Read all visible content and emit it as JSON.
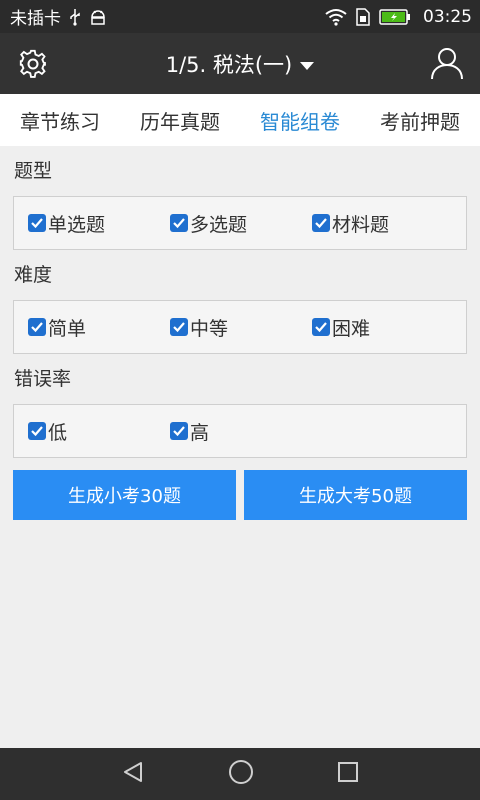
{
  "status_bar": {
    "carrier": "未插卡",
    "time": "03:25",
    "icons": [
      "usb-icon",
      "android-icon",
      "wifi-icon",
      "sim-icon",
      "battery-icon"
    ]
  },
  "header": {
    "title": "1/5. 税法(一)",
    "icons": [
      "gear-icon",
      "chevron-down-icon",
      "user-icon"
    ]
  },
  "tabs": [
    {
      "label": "章节练习",
      "active": false
    },
    {
      "label": "历年真题",
      "active": false
    },
    {
      "label": "智能组卷",
      "active": true
    },
    {
      "label": "考前押题",
      "active": false
    }
  ],
  "sections": {
    "type": {
      "label": "题型",
      "options": [
        {
          "label": "单选题",
          "checked": true
        },
        {
          "label": "多选题",
          "checked": true
        },
        {
          "label": "材料题",
          "checked": true
        }
      ]
    },
    "difficulty": {
      "label": "难度",
      "options": [
        {
          "label": "简单",
          "checked": true
        },
        {
          "label": "中等",
          "checked": true
        },
        {
          "label": "困难",
          "checked": true
        }
      ]
    },
    "error_rate": {
      "label": "错误率",
      "options": [
        {
          "label": "低",
          "checked": true
        },
        {
          "label": "高",
          "checked": true
        }
      ]
    }
  },
  "buttons": {
    "small_exam": "生成小考30题",
    "big_exam": "生成大考50题"
  },
  "colors": {
    "accent": "#2a8ad4",
    "button": "#2a8df3",
    "checkbox": "#1f6fcf",
    "header_bg": "#333333"
  }
}
